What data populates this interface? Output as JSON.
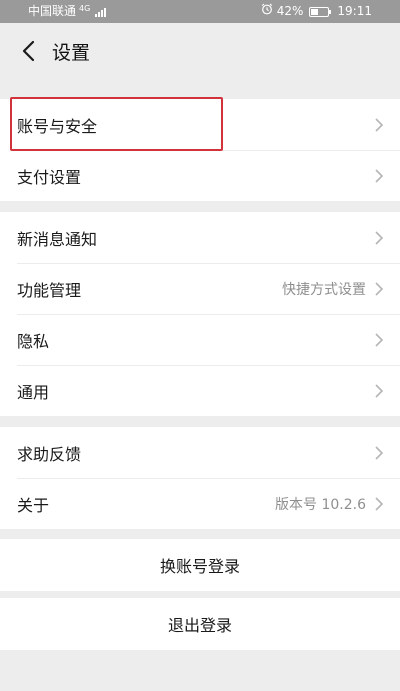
{
  "status_bar": {
    "carrier": "中国联通",
    "network": "4G",
    "battery": "42%",
    "battery_level": 0.42,
    "time": "19:11"
  },
  "nav": {
    "back_icon": "chevron-left-icon",
    "title": "设置"
  },
  "groups": [
    {
      "items": [
        {
          "label": "账号与安全",
          "value": ""
        },
        {
          "label": "支付设置",
          "value": ""
        }
      ]
    },
    {
      "items": [
        {
          "label": "新消息通知",
          "value": ""
        },
        {
          "label": "功能管理",
          "value": "快捷方式设置"
        },
        {
          "label": "隐私",
          "value": ""
        },
        {
          "label": "通用",
          "value": ""
        }
      ]
    },
    {
      "items": [
        {
          "label": "求助反馈",
          "value": ""
        },
        {
          "label": "关于",
          "value": "版本号 10.2.6"
        }
      ]
    }
  ],
  "actions": {
    "switch_account": "换账号登录",
    "logout": "退出登录"
  },
  "colors": {
    "highlight_border": "#d0343a",
    "background": "#ededed",
    "status_bar": "#9a9a9a"
  }
}
